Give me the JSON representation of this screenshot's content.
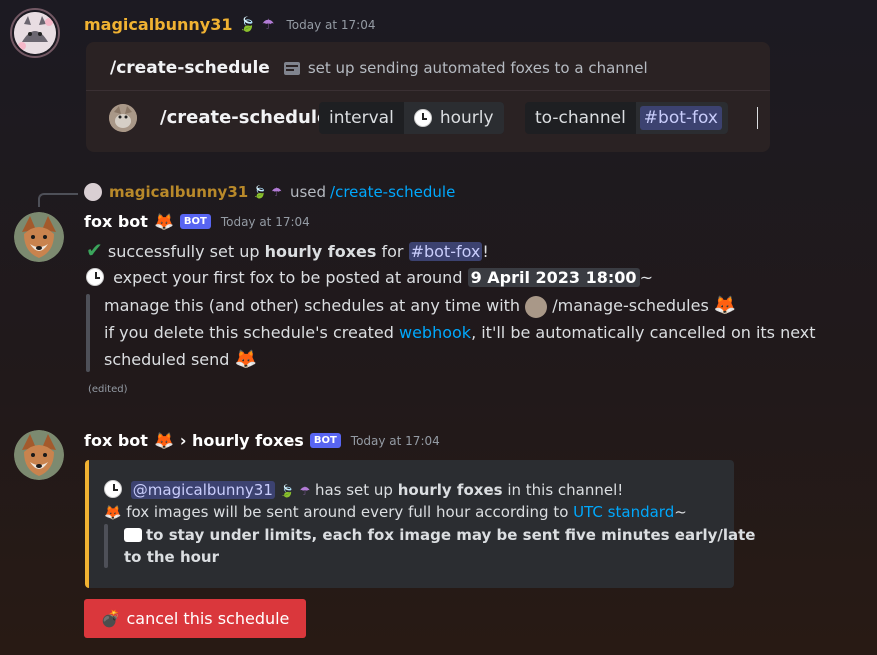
{
  "message1": {
    "username": "magicalbunny31",
    "timestamp": "Today at 17:04",
    "command": {
      "name": "/create-schedule",
      "description": "set up sending automated foxes to a channel",
      "invoked": "/create-schedule",
      "options": [
        {
          "name": "interval",
          "value": "hourly"
        },
        {
          "name": "to-channel",
          "value": "#bot-fox"
        }
      ]
    }
  },
  "reply_ref": {
    "username": "magicalbunny31",
    "used": "used",
    "command": "/create-schedule"
  },
  "message2": {
    "username": "fox bot",
    "bot_tag": "BOT",
    "timestamp": "Today at 17:04",
    "line1": {
      "pre": "successfully set up ",
      "bold": "hourly foxes",
      "mid": " for ",
      "channel": "#bot-fox",
      "post": "!"
    },
    "line2": {
      "pre": "expect your first fox to be posted at around ",
      "date": "9 April 2023 18:00",
      "post": "~"
    },
    "quote1": {
      "pre": "manage this (and other) schedules at any time with ",
      "command": "/manage-schedules"
    },
    "quote2": {
      "pre": "if you delete this schedule's created ",
      "link": "webhook",
      "post": ", it'll be automatically cancelled on its next"
    },
    "quote3": "scheduled send",
    "edited": "(edited)"
  },
  "message3": {
    "username": "fox bot",
    "subtitle": "› hourly foxes",
    "bot_tag": "BOT",
    "timestamp": "Today at 17:04",
    "embed": {
      "line1": {
        "mention": "@magicalbunny31",
        "mid": " has set up ",
        "bold": "hourly foxes",
        "post": " in this channel!"
      },
      "line2": {
        "pre": "fox images will be sent around every full hour according to ",
        "link": "UTC standard",
        "post": "~"
      },
      "quote_line1": "to stay under limits, each fox image may be sent five minutes early/late",
      "quote_line2": "to the hour",
      "accent": "#f0b232"
    },
    "button": {
      "label": "cancel this schedule",
      "color": "#da373c"
    }
  },
  "colors": {
    "username_user": "#f0b232",
    "username_bot": "#ffffff",
    "link": "#00a8fc",
    "bot_tag": "#5865f2"
  }
}
